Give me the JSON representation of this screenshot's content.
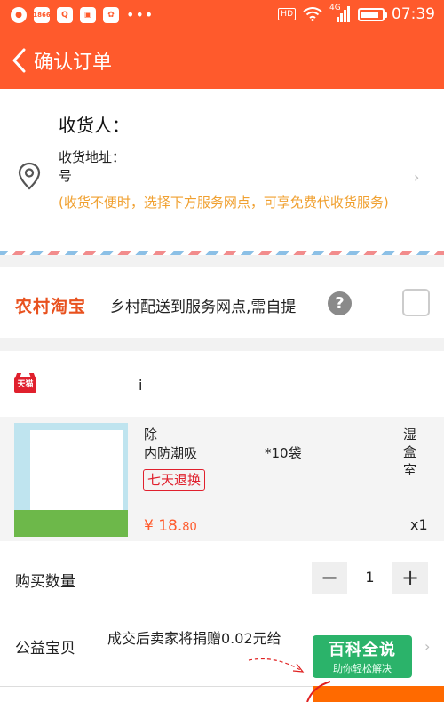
{
  "status_bar": {
    "network_badge_hd": "HD",
    "network_badge_4g": "4G",
    "more": "•••",
    "time": "07:39",
    "battery_percent": 85,
    "notification_icons": [
      "message-icon",
      "1866-app-icon",
      "qq-icon",
      "gallery-icon",
      "baidu-icon"
    ]
  },
  "nav": {
    "title": "确认订单"
  },
  "address": {
    "consignee_label": "收货人：",
    "address_label": "收货地址：",
    "address_line2": "号",
    "note": "(收货不便时，选择下方服务网点，可享免费代收货服务)"
  },
  "rural": {
    "logo_text": "农村淘宝",
    "text": "乡村配送到服务网点,需自提",
    "help_mark": "?"
  },
  "shop": {
    "badge": "天猫",
    "name": "i"
  },
  "product": {
    "title_start": "除",
    "title_end": "湿盒室",
    "title_line2_start": "内防潮吸",
    "title_line2_end": "*10袋",
    "returns_tag": "七天退换",
    "price_main": "¥ 18.",
    "price_cents": "80",
    "quantity_label": "x1"
  },
  "quantity_row": {
    "label": "购买数量",
    "minus": "−",
    "value": "1",
    "plus": "+"
  },
  "charity_row": {
    "label": "公益宝贝",
    "text": "成交后卖家将捐赠0.02元给"
  },
  "watermark": {
    "title": "百科全说",
    "subtitle": "助你轻松解决"
  },
  "colors": {
    "brand": "#ff5a2c",
    "tmall_red": "#e0202d",
    "note_orange": "#f0a030",
    "submit_orange": "#ff6a00"
  }
}
